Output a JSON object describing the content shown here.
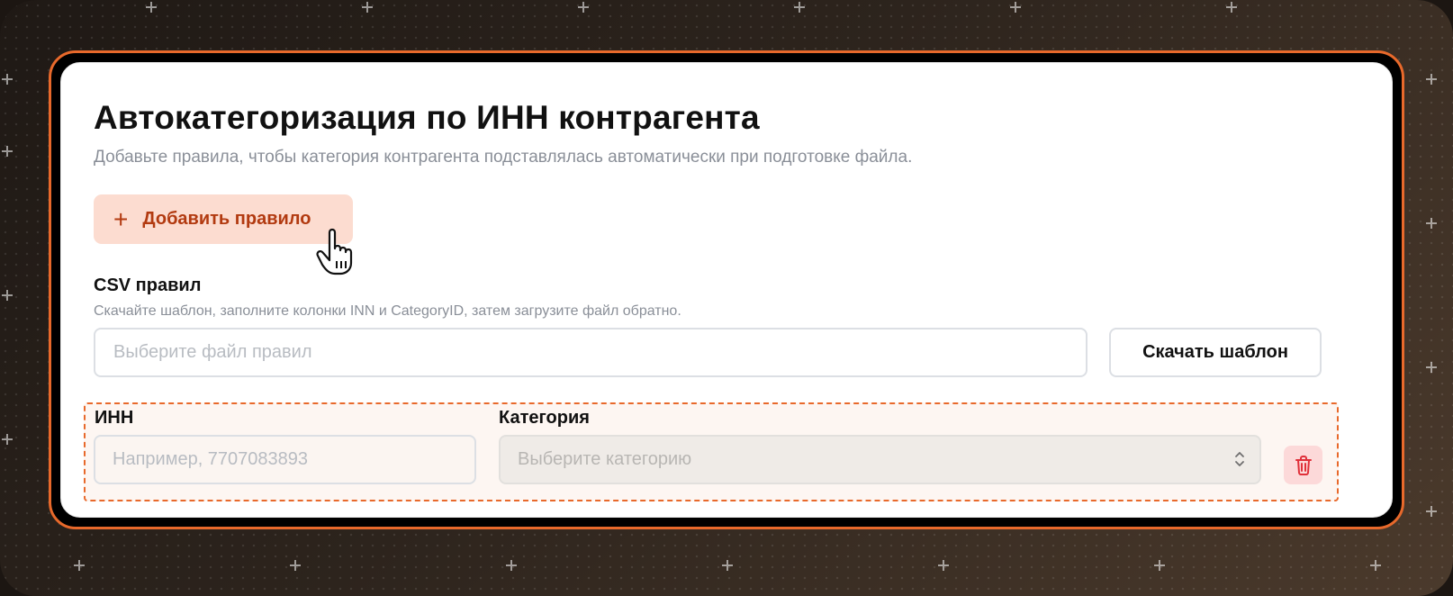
{
  "page": {
    "title": "Автокатегоризация по ИНН контрагента",
    "subtitle": "Добавьте правила, чтобы категория контрагента подставлялась автоматически при подготовке файла."
  },
  "add_rule": {
    "label": "Добавить правило",
    "icon": "plus-icon"
  },
  "csv": {
    "label": "CSV правил",
    "hint": "Скачайте шаблон, заполните колонки INN и CategoryID, затем загрузите файл обратно.",
    "file_placeholder": "Выберите файл правил",
    "download_template_label": "Скачать шаблон"
  },
  "rule": {
    "inn_label": "ИНН",
    "inn_placeholder": "Например, 7707083893",
    "category_label": "Категория",
    "category_placeholder": "Выберите категорию",
    "delete_icon": "trash-icon"
  },
  "colors": {
    "accent": "#e8692b",
    "add_button_bg": "#fcdcd0",
    "add_button_text": "#b23a10",
    "delete_bg": "#fcd9d9",
    "delete_icon": "#e0303a"
  }
}
